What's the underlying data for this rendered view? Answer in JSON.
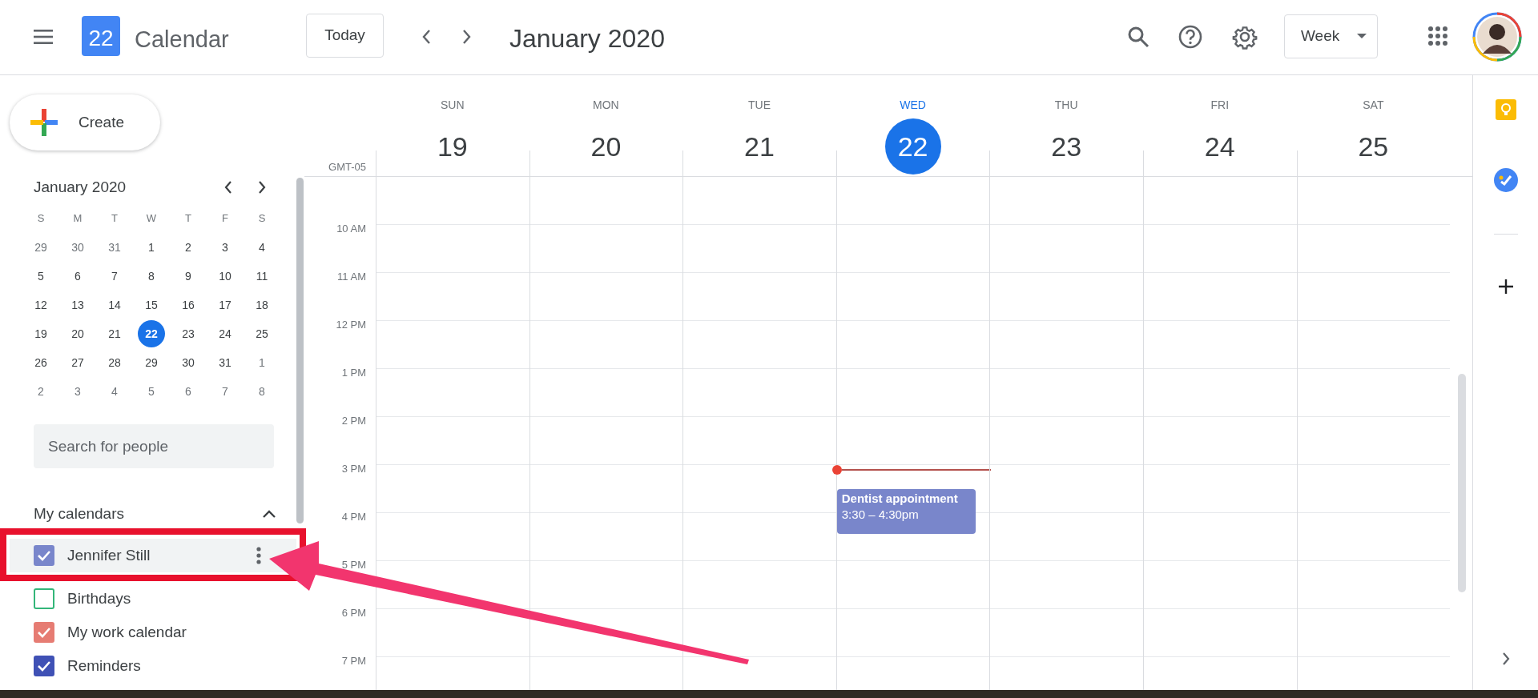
{
  "header": {
    "app_name": "Calendar",
    "logo_day": "22",
    "today_button": "Today",
    "period": "January 2020",
    "view_selector": "Week"
  },
  "sidebar": {
    "create_button": "Create",
    "mini_calendar": {
      "title": "January 2020",
      "weekdays": [
        "S",
        "M",
        "T",
        "W",
        "T",
        "F",
        "S"
      ],
      "weeks": [
        [
          {
            "day": "29",
            "muted": true,
            "selected": false
          },
          {
            "day": "30",
            "muted": true,
            "selected": false
          },
          {
            "day": "31",
            "muted": true,
            "selected": false
          },
          {
            "day": "1",
            "muted": false,
            "selected": false
          },
          {
            "day": "2",
            "muted": false,
            "selected": false
          },
          {
            "day": "3",
            "muted": false,
            "selected": false
          },
          {
            "day": "4",
            "muted": false,
            "selected": false
          }
        ],
        [
          {
            "day": "5",
            "muted": false,
            "selected": false
          },
          {
            "day": "6",
            "muted": false,
            "selected": false
          },
          {
            "day": "7",
            "muted": false,
            "selected": false
          },
          {
            "day": "8",
            "muted": false,
            "selected": false
          },
          {
            "day": "9",
            "muted": false,
            "selected": false
          },
          {
            "day": "10",
            "muted": false,
            "selected": false
          },
          {
            "day": "11",
            "muted": false,
            "selected": false
          }
        ],
        [
          {
            "day": "12",
            "muted": false,
            "selected": false
          },
          {
            "day": "13",
            "muted": false,
            "selected": false
          },
          {
            "day": "14",
            "muted": false,
            "selected": false
          },
          {
            "day": "15",
            "muted": false,
            "selected": false
          },
          {
            "day": "16",
            "muted": false,
            "selected": false
          },
          {
            "day": "17",
            "muted": false,
            "selected": false
          },
          {
            "day": "18",
            "muted": false,
            "selected": false
          }
        ],
        [
          {
            "day": "19",
            "muted": false,
            "selected": false
          },
          {
            "day": "20",
            "muted": false,
            "selected": false
          },
          {
            "day": "21",
            "muted": false,
            "selected": false
          },
          {
            "day": "22",
            "muted": false,
            "selected": true
          },
          {
            "day": "23",
            "muted": false,
            "selected": false
          },
          {
            "day": "24",
            "muted": false,
            "selected": false
          },
          {
            "day": "25",
            "muted": false,
            "selected": false
          }
        ],
        [
          {
            "day": "26",
            "muted": false,
            "selected": false
          },
          {
            "day": "27",
            "muted": false,
            "selected": false
          },
          {
            "day": "28",
            "muted": false,
            "selected": false
          },
          {
            "day": "29",
            "muted": false,
            "selected": false
          },
          {
            "day": "30",
            "muted": false,
            "selected": false
          },
          {
            "day": "31",
            "muted": false,
            "selected": false
          },
          {
            "day": "1",
            "muted": true,
            "selected": false
          }
        ],
        [
          {
            "day": "2",
            "muted": true,
            "selected": false
          },
          {
            "day": "3",
            "muted": true,
            "selected": false
          },
          {
            "day": "4",
            "muted": true,
            "selected": false
          },
          {
            "day": "5",
            "muted": true,
            "selected": false
          },
          {
            "day": "6",
            "muted": true,
            "selected": false
          },
          {
            "day": "7",
            "muted": true,
            "selected": false
          },
          {
            "day": "8",
            "muted": true,
            "selected": false
          }
        ]
      ]
    },
    "people_search": {
      "placeholder": "Search for people"
    },
    "my_calendars": {
      "title": "My calendars",
      "expanded": true,
      "items": [
        {
          "name": "Jennifer Still",
          "checked": true,
          "hovered": true,
          "color": "#7986cb"
        },
        {
          "name": "Birthdays",
          "checked": false,
          "hovered": false,
          "color": "#33b679"
        },
        {
          "name": "My work calendar",
          "checked": true,
          "hovered": false,
          "color": "#e67c73"
        },
        {
          "name": "Reminders",
          "checked": true,
          "hovered": false,
          "color": "#3f51b5"
        }
      ]
    }
  },
  "week_view": {
    "timezone": "GMT-05",
    "days": [
      {
        "weekday": "SUN",
        "date": "19",
        "selected": false
      },
      {
        "weekday": "MON",
        "date": "20",
        "selected": false
      },
      {
        "weekday": "TUE",
        "date": "21",
        "selected": false
      },
      {
        "weekday": "WED",
        "date": "22",
        "selected": true,
        "events": [
          {
            "title": "Dentist appointment",
            "time": "3:30 – 4:30pm",
            "color": "#7986cb"
          }
        ]
      },
      {
        "weekday": "THU",
        "date": "23",
        "selected": false
      },
      {
        "weekday": "FRI",
        "date": "24",
        "selected": false
      },
      {
        "weekday": "SAT",
        "date": "25",
        "selected": false
      }
    ],
    "hours": [
      "10 AM",
      "11 AM",
      "12 PM",
      "1 PM",
      "2 PM",
      "3 PM",
      "4 PM",
      "5 PM",
      "6 PM",
      "7 PM"
    ]
  }
}
